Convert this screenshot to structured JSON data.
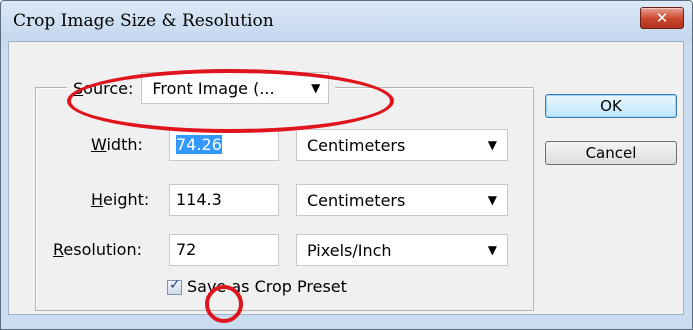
{
  "window": {
    "title": "Crop Image Size & Resolution",
    "close_glyph": "✕",
    "close_icon": "close-icon"
  },
  "source": {
    "label_prefix": "S",
    "label_rest": "ource:",
    "value": "Front Image (... "
  },
  "width": {
    "label_prefix": "W",
    "label_rest": "idth:",
    "value": "74.26",
    "unit": "Centimeters"
  },
  "height": {
    "label_prefix": "H",
    "label_rest": "eight:",
    "value": "114.3",
    "unit": "Centimeters"
  },
  "resolution": {
    "label_prefix": "R",
    "label_rest": "esolution:",
    "value": "72",
    "unit": "Pixels/Inch"
  },
  "save_preset": {
    "checked": true,
    "label": "Save as Crop Preset"
  },
  "buttons": {
    "ok": "OK",
    "cancel": "Cancel"
  },
  "annotation_color": "#e0141d",
  "dropdown_arrow": "▼"
}
